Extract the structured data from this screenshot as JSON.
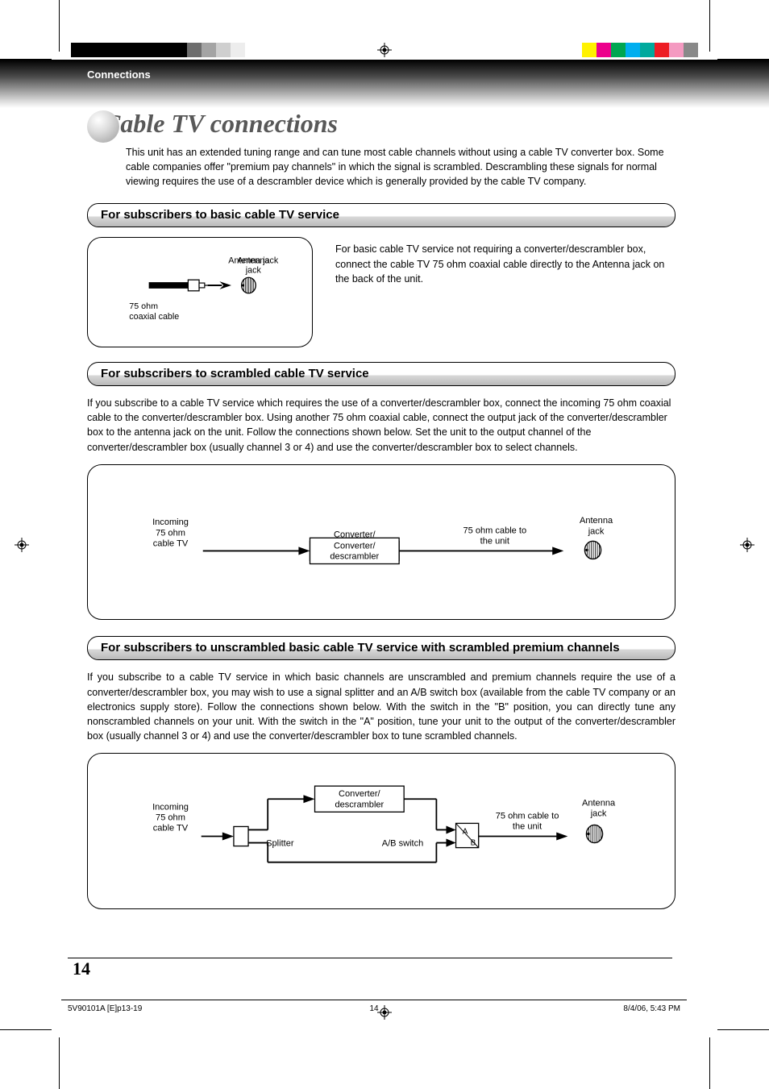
{
  "section_label": "Connections",
  "page_title": "Cable TV connections",
  "intro_text": "This unit has an extended tuning range and can tune most cable channels without using a cable TV converter box. Some cable companies offer \"premium pay channels\" in which the signal is scrambled. Descrambling these signals for normal viewing requires the use of a descrambler device which is generally provided by the cable TV company.",
  "sections": {
    "basic": {
      "heading": "For subscribers to basic cable TV service",
      "side_text": "For basic cable TV service not requiring a converter/descrambler box, connect the cable TV 75 ohm coaxial cable directly to the Antenna jack on the back of the unit.",
      "labels": {
        "antenna_jack": "Antenna jack",
        "coax": "75 ohm coaxial cable"
      }
    },
    "scrambled": {
      "heading": "For subscribers to scrambled cable TV service",
      "body": "If you subscribe to a cable TV service which requires the use of a converter/descrambler box, connect the incoming 75 ohm coaxial cable to the converter/descrambler box. Using another 75 ohm coaxial cable, connect the output jack of the converter/descrambler box to the antenna jack on the unit. Follow the connections shown below. Set the unit to the output channel of the converter/descrambler box (usually channel 3 or 4) and use the converter/descrambler box to select channels.",
      "labels": {
        "incoming": "Incoming 75 ohm cable TV",
        "converter": "Converter/ descrambler",
        "to_unit": "75 ohm cable to the unit",
        "antenna_jack": "Antenna jack"
      }
    },
    "premium": {
      "heading": "For subscribers to unscrambled basic cable TV service with scrambled premium channels",
      "body": "If you subscribe to a cable TV service in which basic channels are unscrambled and premium channels require the use of a converter/descrambler box, you may wish to use a signal splitter and an A/B switch box (available from the cable TV company or an electronics supply store). Follow the connections shown below. With the switch in the \"B\" position, you can directly tune any nonscrambled channels on your unit. With the switch in the \"A\" position, tune your unit to the output of the converter/descrambler box (usually channel 3 or 4) and use the converter/descrambler box to tune scrambled channels.",
      "labels": {
        "incoming": "Incoming 75 ohm cable TV",
        "converter": "Converter/ descrambler",
        "splitter": "Splitter",
        "ab_switch": "A/B switch",
        "a": "A",
        "b": "B",
        "to_unit": "75 ohm cable to the unit",
        "antenna_jack": "Antenna jack"
      }
    }
  },
  "page_number": "14",
  "footer": {
    "left": "5V90101A [E]p13-19",
    "center": "14",
    "right": "8/4/06, 5:43 PM"
  }
}
